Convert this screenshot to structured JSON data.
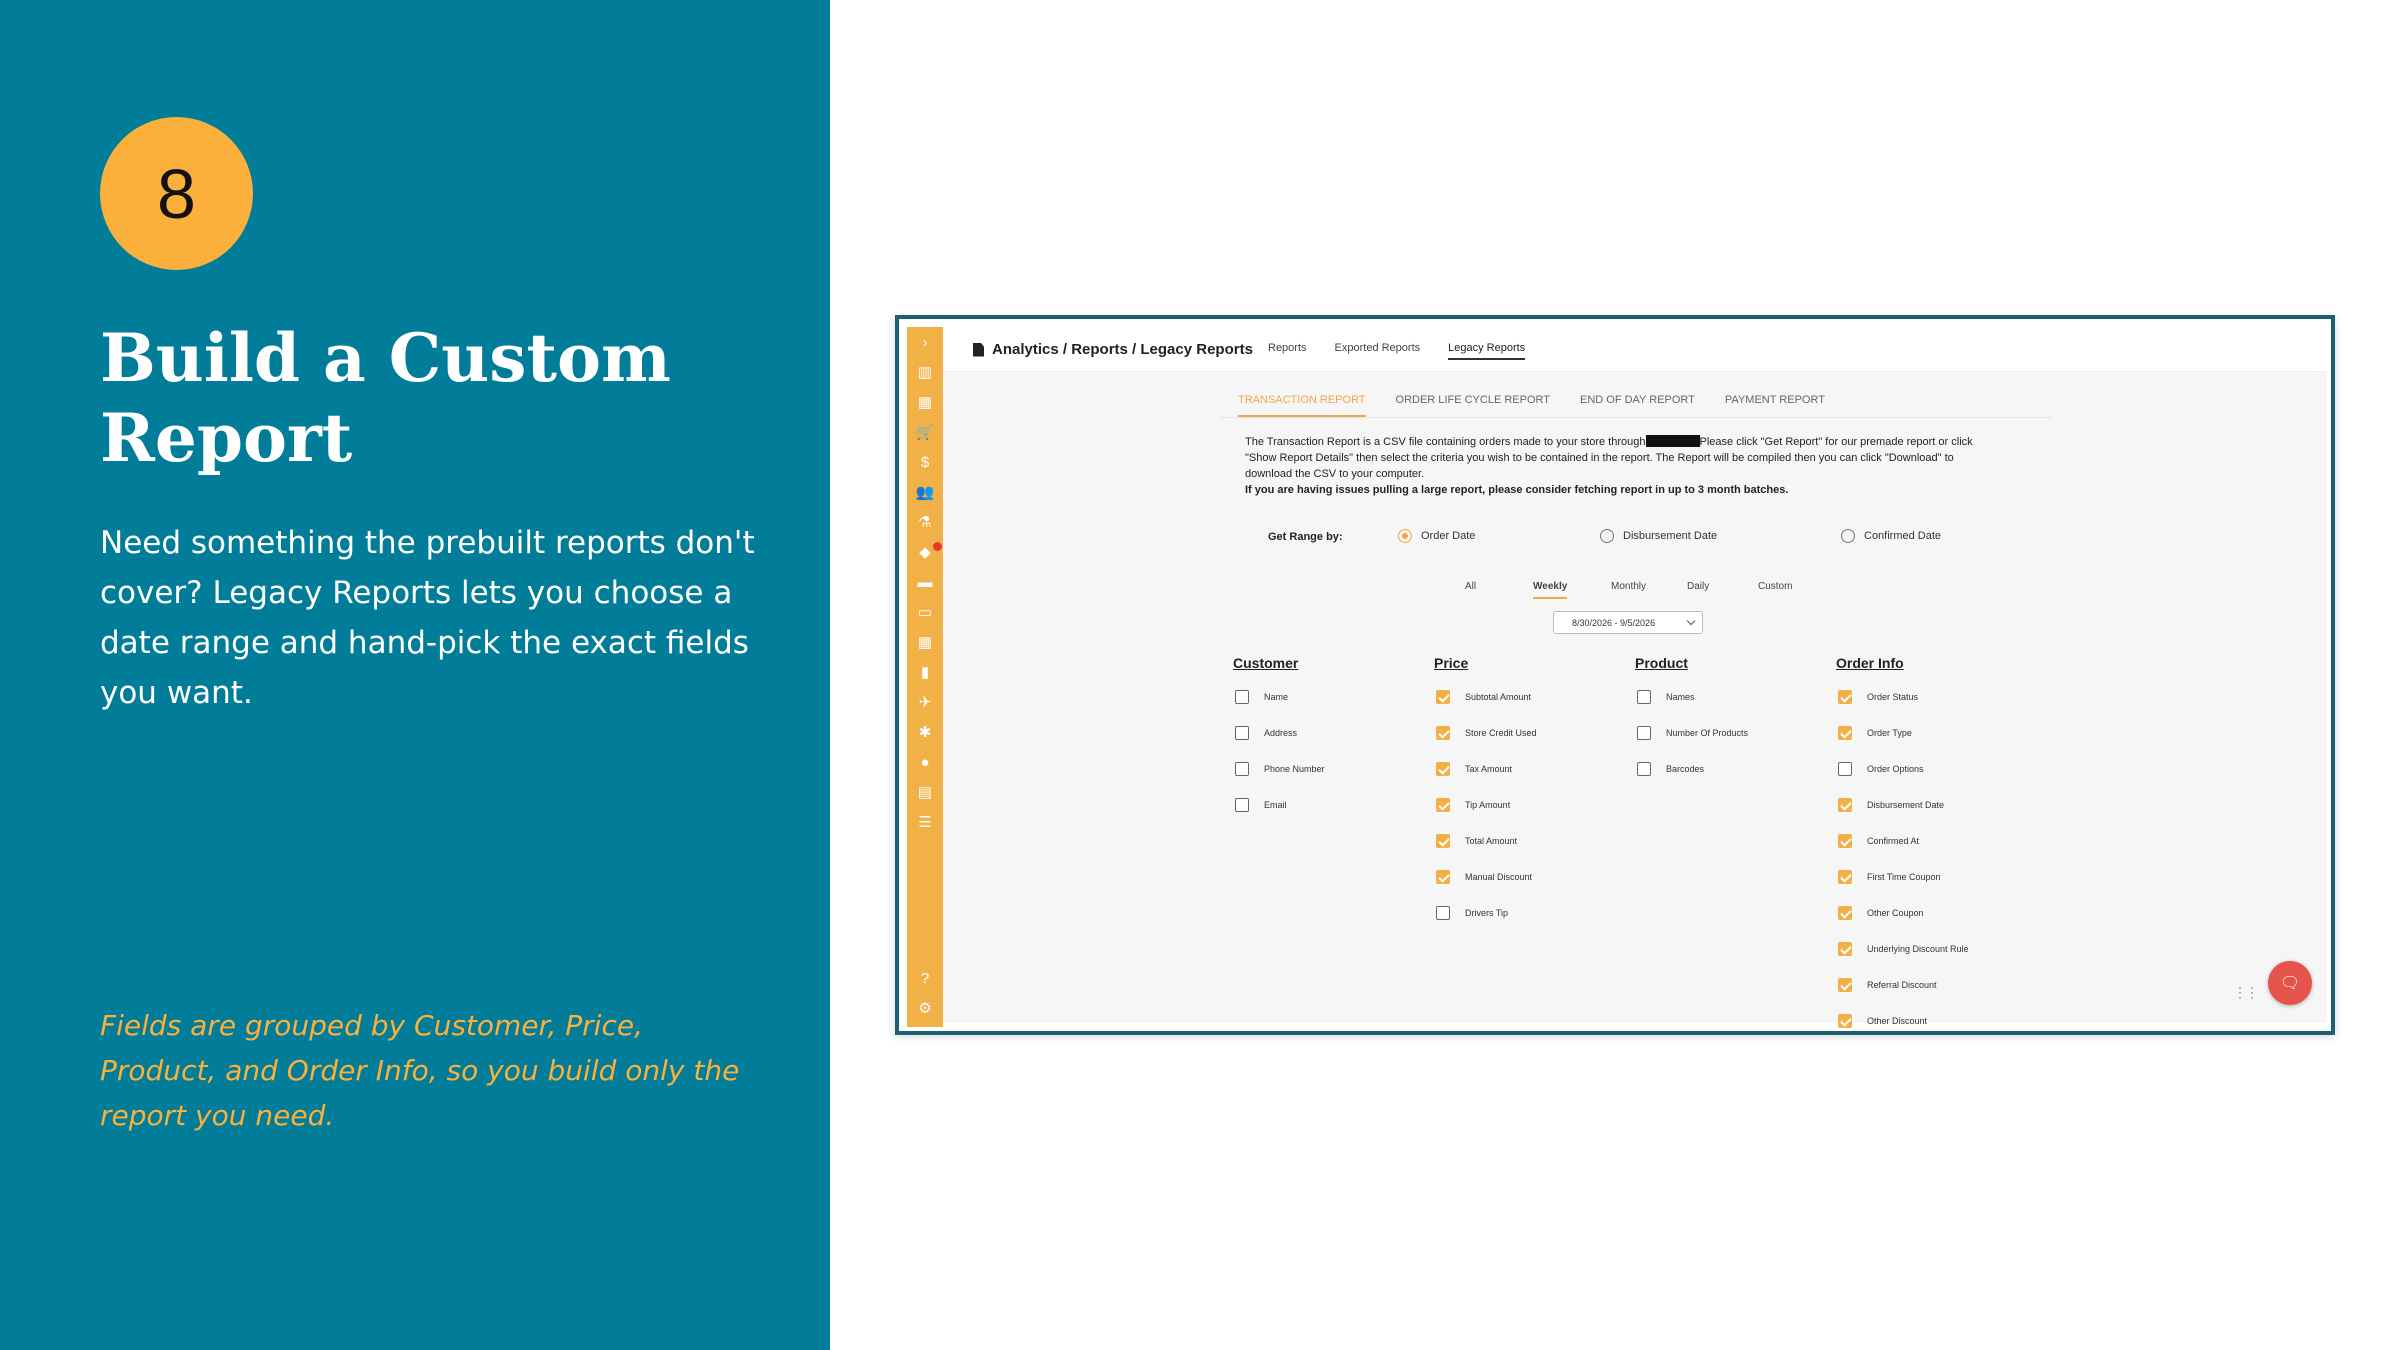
{
  "slide": {
    "step_number": "8",
    "title": "Build a Custom Report",
    "description": "Need something the prebuilt reports don't cover? Legacy Reports lets you choose a date range and hand-pick the exact fields you want.",
    "note": "Fields are grouped by Customer, Price, Product, and Order Info, so you build only the report you need."
  },
  "colors": {
    "panel": "#027d99",
    "accent": "#fbb03b",
    "rail": "#f2b147",
    "chat": "#e5534b"
  },
  "app": {
    "breadcrumb": "Analytics / Reports / Legacy Reports",
    "top_tabs": [
      {
        "label": "Reports",
        "active": false
      },
      {
        "label": "Exported Reports",
        "active": false
      },
      {
        "label": "Legacy Reports",
        "active": true
      }
    ],
    "sidebar_icons": [
      "chevron-right-icon",
      "chart-icon",
      "barcode-icon",
      "cart-icon",
      "dollar-icon",
      "users-icon",
      "flask-icon",
      "tag-icon",
      "truck-icon",
      "card-icon",
      "calendar-icon",
      "book-icon",
      "plane-icon",
      "puzzle-icon",
      "bulb-icon",
      "printer-icon",
      "database-icon"
    ],
    "sidebar_bottom_icons": [
      "help-icon",
      "gear-icon"
    ],
    "report_tabs": [
      {
        "label": "TRANSACTION REPORT",
        "active": true
      },
      {
        "label": "ORDER LIFE CYCLE REPORT",
        "active": false
      },
      {
        "label": "END OF DAY REPORT",
        "active": false
      },
      {
        "label": "PAYMENT REPORT",
        "active": false
      }
    ],
    "info_line1_before": "The Transaction Report is a CSV file containing orders made to your store through",
    "info_line1_after": "Please click \"Get Report\" for our premade report or click",
    "info_line2": "\"Show Report Details\" then select the criteria you wish to be contained in the report. The Report will be compiled then you can click \"Download\" to",
    "info_line3": "download the CSV to your computer.",
    "info_bold": "If you are having issues pulling a large report, please consider fetching report in up to 3 month batches.",
    "range_label": "Get Range by:",
    "range_options": [
      {
        "label": "Order Date",
        "selected": true
      },
      {
        "label": "Disbursement Date",
        "selected": false
      },
      {
        "label": "Confirmed Date",
        "selected": false
      }
    ],
    "periods": [
      {
        "label": "All",
        "active": false
      },
      {
        "label": "Weekly",
        "active": true
      },
      {
        "label": "Monthly",
        "active": false
      },
      {
        "label": "Daily",
        "active": false
      },
      {
        "label": "Custom",
        "active": false
      }
    ],
    "date_range_value": "8/30/2026 - 9/5/2026",
    "groups": [
      {
        "title": "Customer",
        "fields": [
          {
            "label": "Name",
            "checked": false
          },
          {
            "label": "Address",
            "checked": false
          },
          {
            "label": "Phone Number",
            "checked": false
          },
          {
            "label": "Email",
            "checked": false
          }
        ]
      },
      {
        "title": "Price",
        "fields": [
          {
            "label": "Subtotal Amount",
            "checked": true
          },
          {
            "label": "Store Credit Used",
            "checked": true
          },
          {
            "label": "Tax Amount",
            "checked": true
          },
          {
            "label": "Tip Amount",
            "checked": true
          },
          {
            "label": "Total Amount",
            "checked": true
          },
          {
            "label": "Manual Discount",
            "checked": true
          },
          {
            "label": "Drivers Tip",
            "checked": false
          }
        ]
      },
      {
        "title": "Product",
        "fields": [
          {
            "label": "Names",
            "checked": false
          },
          {
            "label": "Number Of Products",
            "checked": false
          },
          {
            "label": "Barcodes",
            "checked": false
          }
        ]
      },
      {
        "title": "Order Info",
        "fields": [
          {
            "label": "Order Status",
            "checked": true
          },
          {
            "label": "Order Type",
            "checked": true
          },
          {
            "label": "Order Options",
            "checked": false
          },
          {
            "label": "Disbursement Date",
            "checked": true
          },
          {
            "label": "Confirmed At",
            "checked": true
          },
          {
            "label": "First Time Coupon",
            "checked": true
          },
          {
            "label": "Other Coupon",
            "checked": true
          },
          {
            "label": "Underlying Discount Rule",
            "checked": true
          },
          {
            "label": "Referral Discount",
            "checked": true
          },
          {
            "label": "Other Discount",
            "checked": true
          }
        ]
      }
    ]
  }
}
